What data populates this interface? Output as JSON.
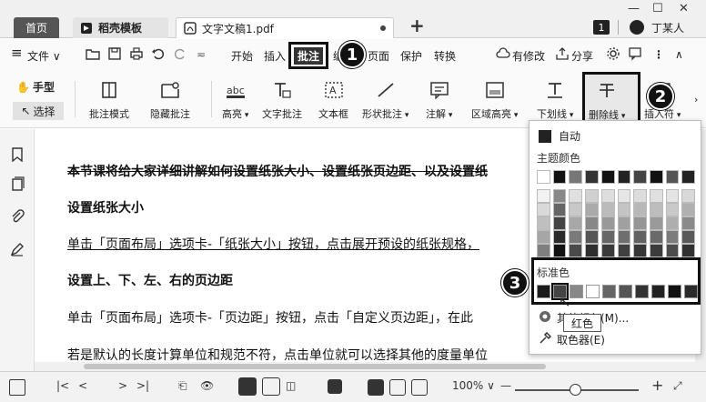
{
  "tabs": {
    "home": "首页",
    "template": "稻壳模板",
    "doc": "文字文稿1.pdf"
  },
  "window": {
    "minimize": "—",
    "maximize": "☐",
    "close": "✕",
    "badge": "1",
    "user_name": "丁某人"
  },
  "menubar": {
    "menu_icon": "≡",
    "file": "文件",
    "start": "开始",
    "insert": "插入",
    "annotate": "批注",
    "edit": "编辑",
    "page": "页面",
    "protect": "保护",
    "convert": "转换",
    "modified": "有修改",
    "share": "分享"
  },
  "callouts": {
    "one": "1",
    "two": "2",
    "three": "3"
  },
  "ribbon": {
    "hand_tool": "手型",
    "select_tool": "选择",
    "annotate_mode": "批注模式",
    "hide_annotate": "隐藏批注",
    "highlight": "高亮",
    "text_annotate": "文字批注",
    "text_box": "文本框",
    "shape_annotate": "形状批注",
    "note": "注解",
    "area_highlight": "区域高亮",
    "underline": "下划线",
    "strikethrough": "删除线",
    "insert_symbol": "插入符"
  },
  "document": {
    "lines": [
      "本节课将给大家详细讲解如何设置纸张大小、设置纸张页边距、以及设置纸",
      "设置纸张大小",
      "单击「页面布局」选项卡-「纸张大小」按钮，点击展开预设的纸张规格，",
      "设置上、下、左、右的页边距",
      "单击「页面布局」选项卡-「页边距」按钮，点击「自定义页边距」，在此",
      "若是默认的长度计算单位和规范不符，点击单位就可以选择其他的度量单位"
    ]
  },
  "dropdown": {
    "auto": "自动",
    "theme_colors": "主题颜色",
    "standard_colors": "标准色",
    "more_colors": "其他颜色(M)...",
    "eyedropper": "取色器(E)",
    "tooltip": "红色"
  },
  "statusbar": {
    "zoom": "100%",
    "minus": "—",
    "plus": "+"
  }
}
